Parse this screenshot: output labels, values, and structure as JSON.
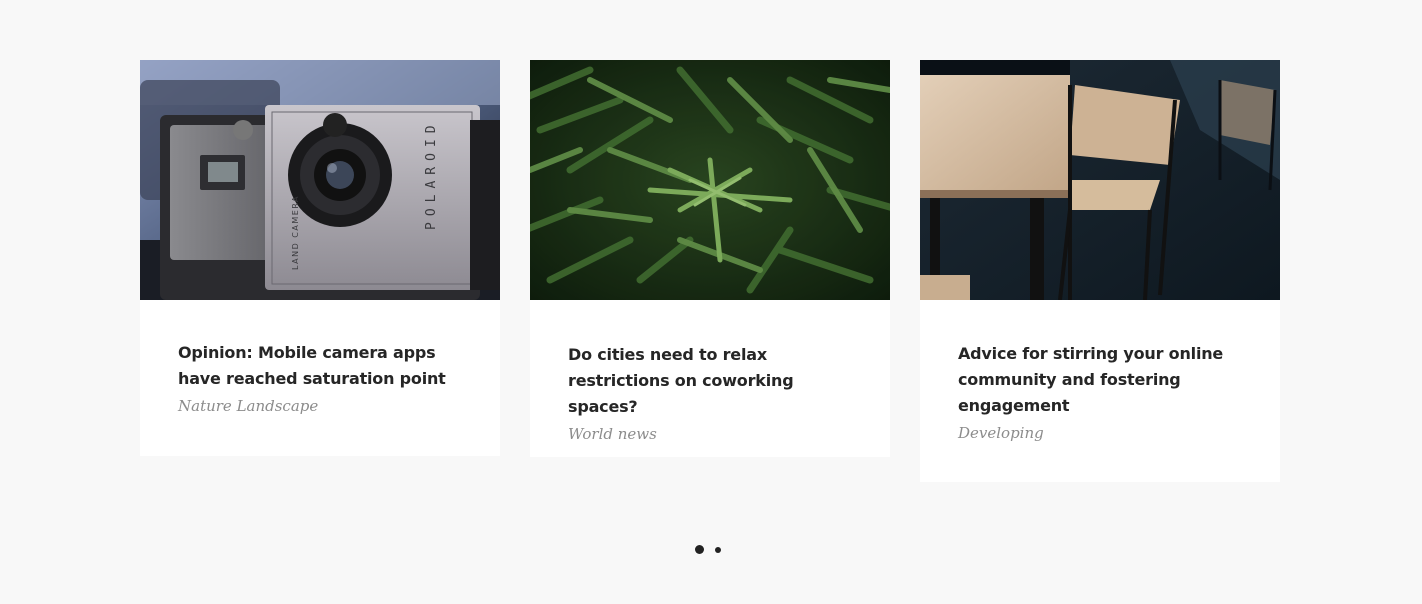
{
  "posts": [
    {
      "title": "Opinion: Mobile camera apps have reached saturation point",
      "category": "Nature Landscape",
      "image": "polaroid-land-camera-photo"
    },
    {
      "title": "Do cities need to relax restrictions on coworking spaces?",
      "category": "World news",
      "image": "fern-leaves-photo"
    },
    {
      "title": "Advice for stirring your online community and fostering engagement",
      "category": "Developing",
      "image": "wooden-table-chairs-photo"
    }
  ],
  "pagination": {
    "pages": 2,
    "active": 1
  },
  "colors": {
    "background": "#f8f8f8",
    "card": "#ffffff",
    "title": "#262626",
    "category": "#8c8c8c",
    "dot": "#222222"
  }
}
